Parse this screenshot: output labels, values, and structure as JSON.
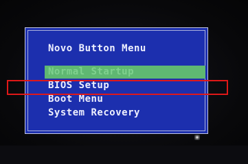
{
  "menu": {
    "title": "Novo Button Menu",
    "items": [
      {
        "label": "Normal Startup",
        "selected": true
      },
      {
        "label": "BIOS Setup",
        "selected": false,
        "annotated": true
      },
      {
        "label": "Boot Menu",
        "selected": false
      },
      {
        "label": "System Recovery",
        "selected": false
      }
    ]
  },
  "colors": {
    "panel_background": "#1c2fae",
    "text": "#eef0ff",
    "selection_bar": "#5fb872",
    "annotation_box": "#e01818"
  }
}
